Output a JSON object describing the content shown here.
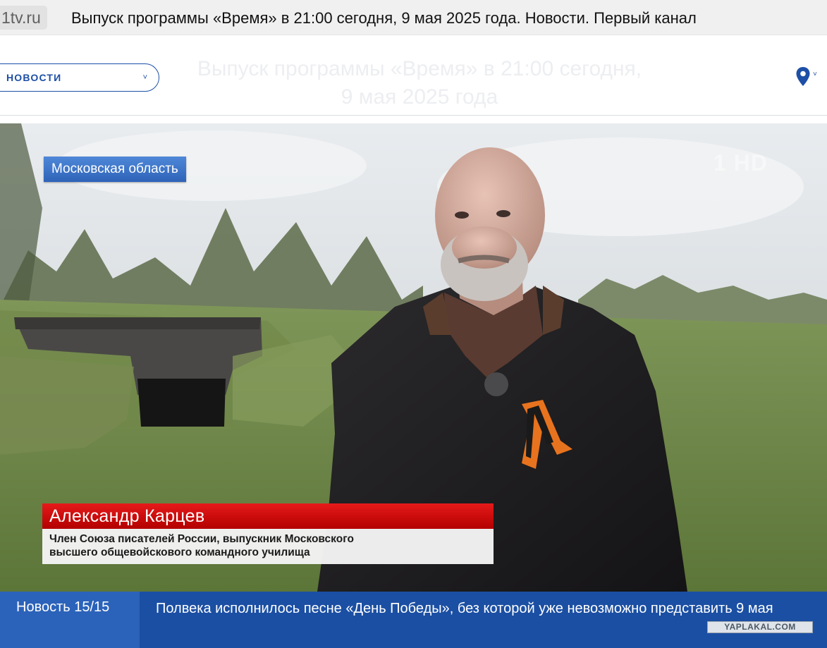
{
  "browser": {
    "site": "1tv.ru",
    "page_title": "Выпуск программы «Время» в 21:00 сегодня, 9 мая 2025 года. Новости. Первый канал"
  },
  "header": {
    "ghost_title_line1": "Выпуск программы «Время» в 21:00 сегодня,",
    "ghost_title_line2": "9 мая 2025 года",
    "section_label": "НОВОСТИ",
    "section_chevron": "˅",
    "location_icon": "location-pin-icon",
    "accent_color": "#1d4fa6"
  },
  "video": {
    "location_caption": "Московская область",
    "channel_logo": "1 HD",
    "person_name": "Александр Карцев",
    "person_description_line1": "Член Союза писателей России, выпускник Московского",
    "person_description_line2": "высшего общевойскового командного училища"
  },
  "news_bar": {
    "counter": "Новость 15/15",
    "headline": "Полвека исполнилось песне «День Победы», без которой уже невозможно представить 9 мая",
    "watermark": "YAPLAKAL.COM",
    "bar_color": "#1b4fa3"
  }
}
